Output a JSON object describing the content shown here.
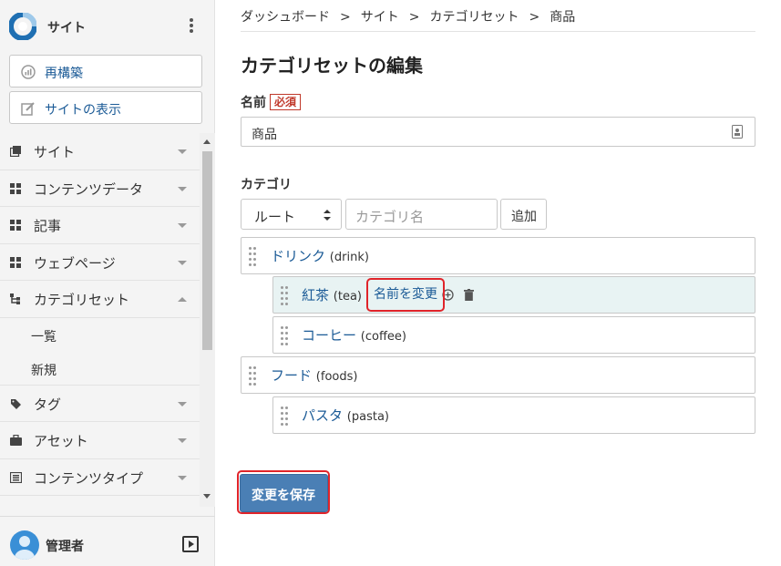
{
  "sidebar": {
    "site_name": "サイト",
    "rebuild_label": "再構築",
    "view_site_label": "サイトの表示",
    "menu": [
      {
        "label": "サイト",
        "icon": "copy-icon"
      },
      {
        "label": "コンテンツデータ",
        "icon": "grid-icon"
      },
      {
        "label": "記事",
        "icon": "grid-icon"
      },
      {
        "label": "ウェブページ",
        "icon": "grid-icon"
      },
      {
        "label": "カテゴリセット",
        "icon": "hierarchy-icon"
      }
    ],
    "submenu": [
      {
        "label": "一覧"
      },
      {
        "label": "新規"
      }
    ],
    "menu2": [
      {
        "label": "タグ",
        "icon": "tag-icon"
      },
      {
        "label": "アセット",
        "icon": "briefcase-icon"
      },
      {
        "label": "コンテンツタイプ",
        "icon": "list-icon"
      }
    ],
    "user_name": "管理者"
  },
  "breadcrumb": [
    "ダッシュボード",
    "サイト",
    "カテゴリセット",
    "商品"
  ],
  "breadcrumb_separator": ">",
  "page_title": "カテゴリセットの編集",
  "name_field": {
    "label": "名前",
    "required_label": "必須",
    "value": "商品"
  },
  "category": {
    "label": "カテゴリ",
    "parent_select": "ルート",
    "name_placeholder": "カテゴリ名",
    "add_label": "追加",
    "tree": [
      {
        "name": "ドリンク",
        "slug": "(drink)"
      },
      {
        "name": "紅茶",
        "slug": "(tea)",
        "rename_label": "名前を変更"
      },
      {
        "name": "コーヒー",
        "slug": "(coffee)"
      },
      {
        "name": "フード",
        "slug": "(foods)"
      },
      {
        "name": "パスタ",
        "slug": "(pasta)"
      }
    ]
  },
  "save_label": "変更を保存",
  "colors": {
    "link": "#1a5a96",
    "primary_button": "#4a7fb5",
    "highlight_row": "#e8f3f3",
    "annotation_red": "#e0242a",
    "required": "#c0392b"
  }
}
